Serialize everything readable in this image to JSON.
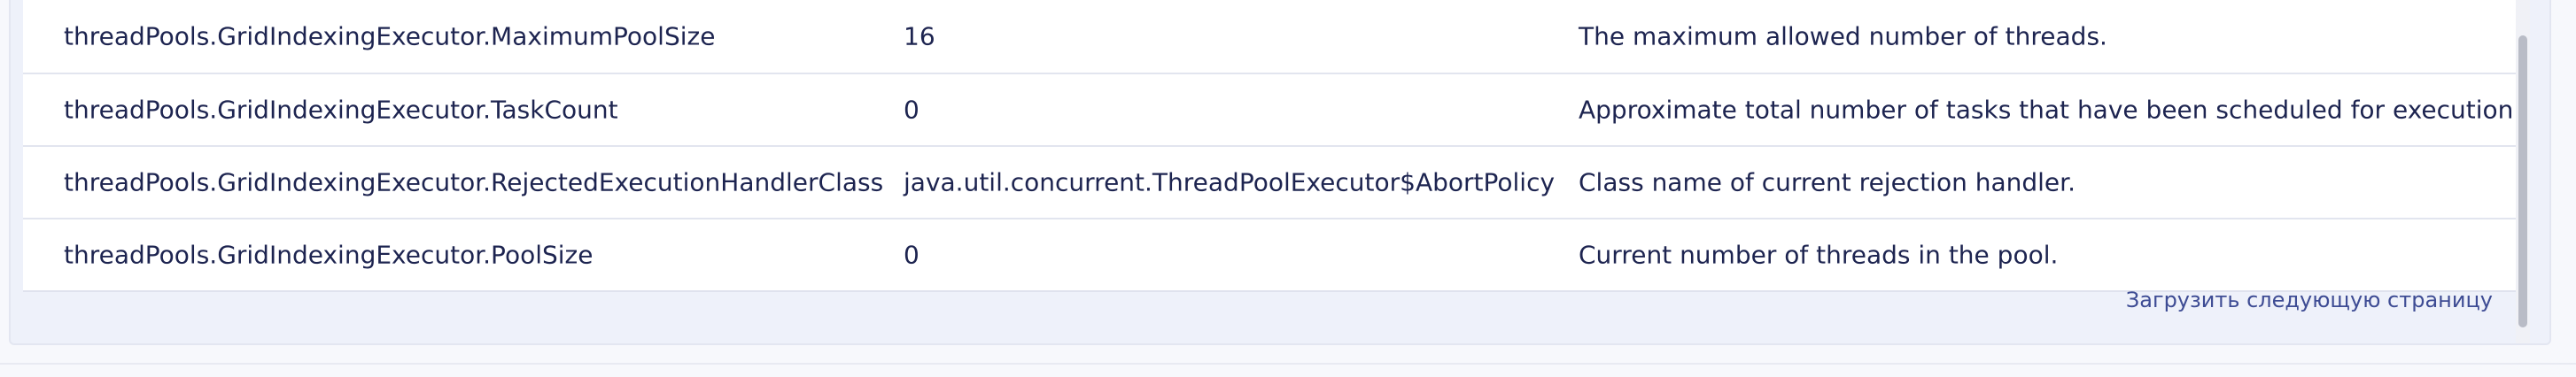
{
  "table": {
    "rows": [
      {
        "name": "threadPools.GridIndexingExecutor.MaximumPoolSize",
        "value": "16",
        "description": "The maximum allowed number of threads."
      },
      {
        "name": "threadPools.GridIndexingExecutor.TaskCount",
        "value": "0",
        "description": "Approximate total number of tasks that have been scheduled for execution."
      },
      {
        "name": "threadPools.GridIndexingExecutor.RejectedExecutionHandlerClass",
        "value": "java.util.concurrent.ThreadPoolExecutor$AbortPolicy",
        "description": "Class name of current rejection handler."
      },
      {
        "name": "threadPools.GridIndexingExecutor.PoolSize",
        "value": "0",
        "description": "Current number of threads in the pool."
      }
    ]
  },
  "footer": {
    "load_more_label": "Загрузить следующую страницу"
  }
}
